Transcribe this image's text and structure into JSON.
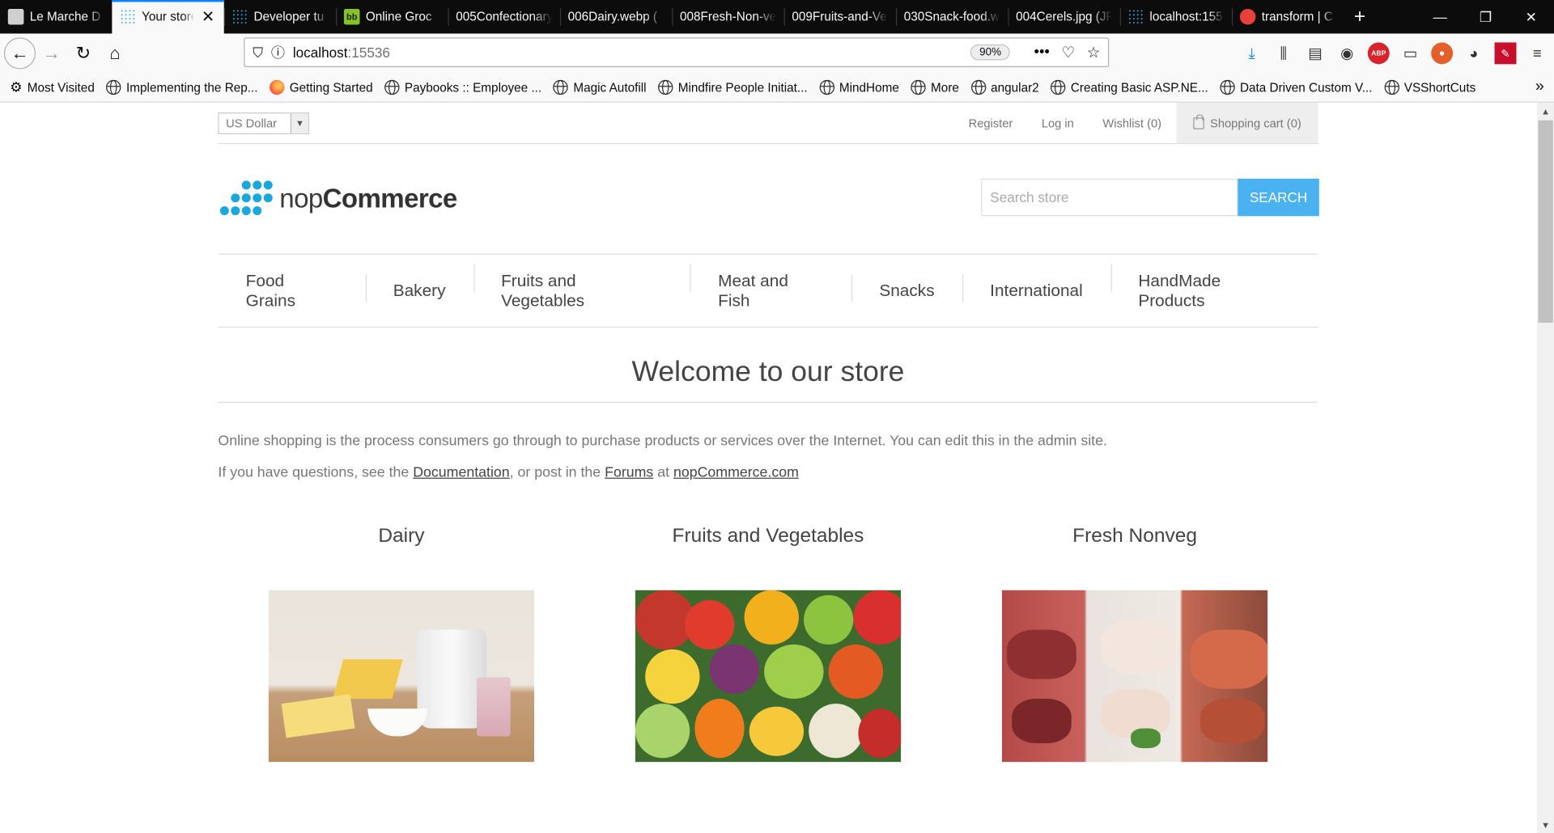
{
  "browser": {
    "tabs": [
      {
        "label": "Le Marche D",
        "icon": "cube-icon",
        "active": false
      },
      {
        "label": "Your store",
        "icon": "nopcommerce-icon",
        "active": true
      },
      {
        "label": "Developer tu",
        "icon": "nopcommerce-icon",
        "active": false
      },
      {
        "label": "Online Groc",
        "icon": "bigbasket-icon",
        "active": false
      },
      {
        "label": "005Confectionary",
        "icon": "",
        "active": false
      },
      {
        "label": "006Dairy.webp (",
        "icon": "",
        "active": false
      },
      {
        "label": "008Fresh-Non-ve",
        "icon": "",
        "active": false
      },
      {
        "label": "009Fruits-and-Ve",
        "icon": "",
        "active": false
      },
      {
        "label": "030Snack-food.w",
        "icon": "",
        "active": false
      },
      {
        "label": "004Cerels.jpg (JP",
        "icon": "",
        "active": false
      },
      {
        "label": "localhost:155",
        "icon": "nopcommerce-icon",
        "active": false
      },
      {
        "label": "transform | C",
        "icon": "transform-icon",
        "active": false
      }
    ],
    "url_host": "localhost",
    "url_port": ":15536",
    "zoom": "90%",
    "bookmarks": [
      {
        "label": "Most Visited",
        "icon": "gear-icon"
      },
      {
        "label": "Implementing the Rep...",
        "icon": "globe-icon"
      },
      {
        "label": "Getting Started",
        "icon": "firefox-icon"
      },
      {
        "label": "Paybooks :: Employee ...",
        "icon": "globe-icon"
      },
      {
        "label": "Magic Autofill",
        "icon": "globe-icon"
      },
      {
        "label": "Mindfire People Initiat...",
        "icon": "globe-icon"
      },
      {
        "label": "MindHome",
        "icon": "globe-icon"
      },
      {
        "label": "More",
        "icon": "globe-icon"
      },
      {
        "label": "angular2",
        "icon": "globe-icon"
      },
      {
        "label": "Creating Basic ASP.NE...",
        "icon": "globe-icon"
      },
      {
        "label": "Data Driven Custom V...",
        "icon": "globe-icon"
      },
      {
        "label": "VSShortCuts",
        "icon": "globe-icon"
      }
    ]
  },
  "store": {
    "currency": "US Dollar",
    "header_links": {
      "register": "Register",
      "login": "Log in",
      "wishlist": "Wishlist (0)",
      "cart": "Shopping cart (0)"
    },
    "logo_prefix": "nop",
    "logo_suffix": "Commerce",
    "search_placeholder": "Search store",
    "search_button": "SEARCH",
    "menu": [
      "Food Grains",
      "Bakery",
      "Fruits and Vegetables",
      "Meat and Fish",
      "Snacks",
      "International",
      "HandMade Products"
    ],
    "welcome_title": "Welcome to our store",
    "intro_line1": "Online shopping is the process consumers go through to purchase products or services over the Internet. You can edit this in the admin site.",
    "intro_line2_a": "If you have questions, see the ",
    "intro_link_docs": "Documentation",
    "intro_line2_b": ", or post in the ",
    "intro_link_forums": "Forums",
    "intro_line2_c": " at ",
    "intro_link_site": "nopCommerce.com",
    "categories": [
      {
        "title": "Dairy"
      },
      {
        "title": "Fruits and Vegetables"
      },
      {
        "title": "Fresh Nonveg"
      }
    ]
  },
  "colors": {
    "accent": "#4ab2f1",
    "logo": "#1aa6de",
    "tab_active_line": "#0a84ff"
  }
}
